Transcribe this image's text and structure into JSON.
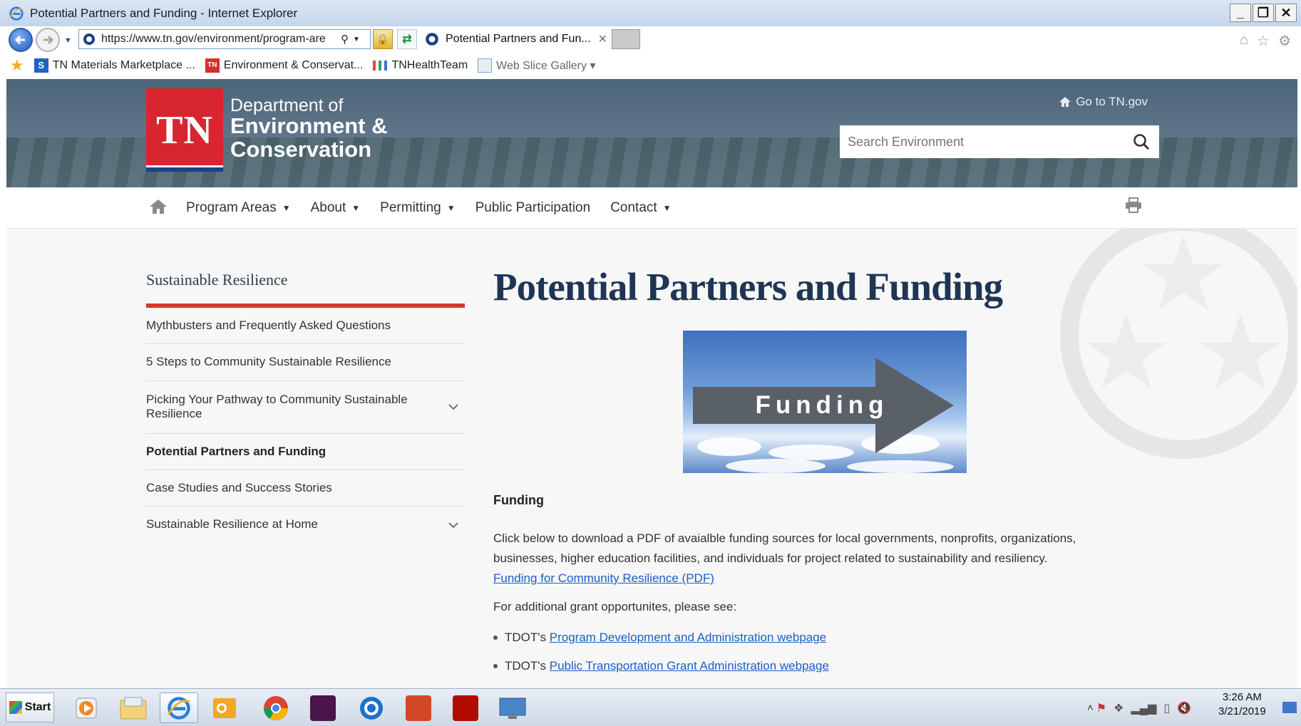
{
  "window": {
    "title": "Potential Partners and Funding - Internet Explorer",
    "controls": [
      "_",
      "❐",
      "✕"
    ]
  },
  "address_bar": {
    "url": "https://www.tn.gov/environment/program-are",
    "tab_title": "Potential Partners and Fun...",
    "tab_close": "✕"
  },
  "favorites": [
    {
      "label": "TN Materials Marketplace ...",
      "icon": "sp-icon"
    },
    {
      "label": "Environment & Conservat...",
      "icon": "tn-icon"
    },
    {
      "label": "TNHealthTeam",
      "icon": "bars-icon"
    },
    {
      "label": "Web Slice Gallery ▾",
      "icon": "web-slice-icon"
    }
  ],
  "header": {
    "logo_text": "TN",
    "dept_line1": "Department of",
    "dept_line2": "Environment &",
    "dept_line3": "Conservation",
    "goto_link": "Go to TN.gov",
    "search_placeholder": "Search Environment"
  },
  "nav": {
    "items": [
      {
        "label": "Program Areas",
        "caret": "▼"
      },
      {
        "label": "About",
        "caret": "▼"
      },
      {
        "label": "Permitting",
        "caret": "▼"
      },
      {
        "label": "Public Participation",
        "caret": ""
      },
      {
        "label": "Contact",
        "caret": "▼"
      }
    ]
  },
  "sidebar": {
    "title": "Sustainable Resilience",
    "items": [
      {
        "label": "Mythbusters and Frequently Asked Questions"
      },
      {
        "label": "5 Steps to Community Sustainable Resilience"
      },
      {
        "label": "Picking Your Pathway to Community Sustainable Resilience"
      },
      {
        "label": "Potential Partners and Funding"
      },
      {
        "label": "Case Studies and Success Stories"
      },
      {
        "label": "Sustainable Resilience at Home"
      }
    ]
  },
  "main": {
    "title": "Potential Partners and Funding",
    "hero_text": "Funding",
    "section_heading": "Funding",
    "paragraph": "Click below to download a PDF of avaialble funding sources for local governments, nonprofits, organizations, businesses, higher education facilities, and individuals for project related to sustainability and resiliency.",
    "pdf_link": "Funding for Community Resilience (PDF)",
    "grant_intro": "For additional grant opportunites, please see:",
    "bullets": [
      {
        "prefix": "TDOT's",
        "link": "Program Development and Administration webpage"
      },
      {
        "prefix": "TDOT's",
        "link": "Public Transportation Grant Administration webpage"
      }
    ]
  },
  "taskbar": {
    "start_label": "Start",
    "time": "3:26 AM",
    "date": "3/21/2019",
    "tray_chevron": "˄"
  },
  "colors": {
    "tn_red": "#d72630",
    "tn_blue": "#1e3f88",
    "title_navy": "#1f3554",
    "link_blue": "#1a5fc2",
    "sidebar_accent": "#d9362b"
  }
}
